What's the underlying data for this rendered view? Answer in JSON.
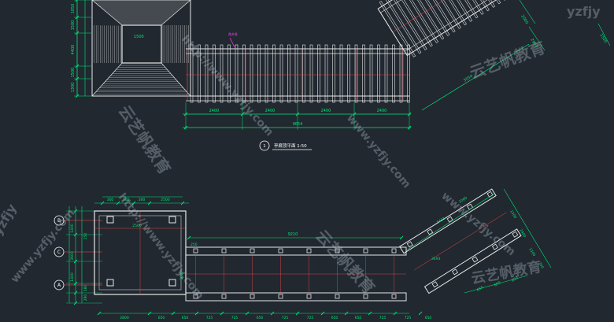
{
  "colors": {
    "background": "#212830",
    "dimension": "#00e676",
    "structure": "#e8e8e8",
    "red": "#ff4d4d",
    "magenta": "#ff40ff",
    "axis": "#ffffff",
    "watermark": "#b7c3cf"
  },
  "top_plan": {
    "left_dims": [
      "1050",
      "1500",
      "4400",
      "1500",
      "1300"
    ],
    "bottom_dims": [
      "2400",
      "2400",
      "2400",
      "2400"
    ],
    "total_dim": "9654",
    "ramp_dims": [
      "3054",
      "2060",
      "2050",
      "1500"
    ],
    "small_label": "1500",
    "magenta_label": "角木条",
    "caption_number": "1",
    "caption_text": "亭廊顶平面 1:50"
  },
  "bottom_plan": {
    "grid_labels": [
      "B",
      "C",
      "A"
    ],
    "left_dims": [
      "1400",
      "3600",
      "1400",
      "180",
      "280",
      "250"
    ],
    "top_dims": [
      "300",
      "300",
      "300",
      "2500"
    ],
    "main_length": "9210",
    "side_labels": [
      "250",
      "3800"
    ],
    "ramp_labels": [
      "5433",
      "3493",
      "1060"
    ],
    "right_labels": [
      "1300",
      "2400",
      "1300",
      "200"
    ],
    "bottom_dims": [
      "2800",
      "650",
      "650",
      "725",
      "725",
      "650",
      "725",
      "725",
      "650",
      "650",
      "725",
      "725",
      "650"
    ],
    "ramp_bottom_dims": [
      "650",
      "650",
      "650"
    ]
  },
  "watermarks": [
    "www.yzfjy.com",
    "yzfjy",
    "云艺帆教育",
    "http://www.yzfjy.com"
  ]
}
